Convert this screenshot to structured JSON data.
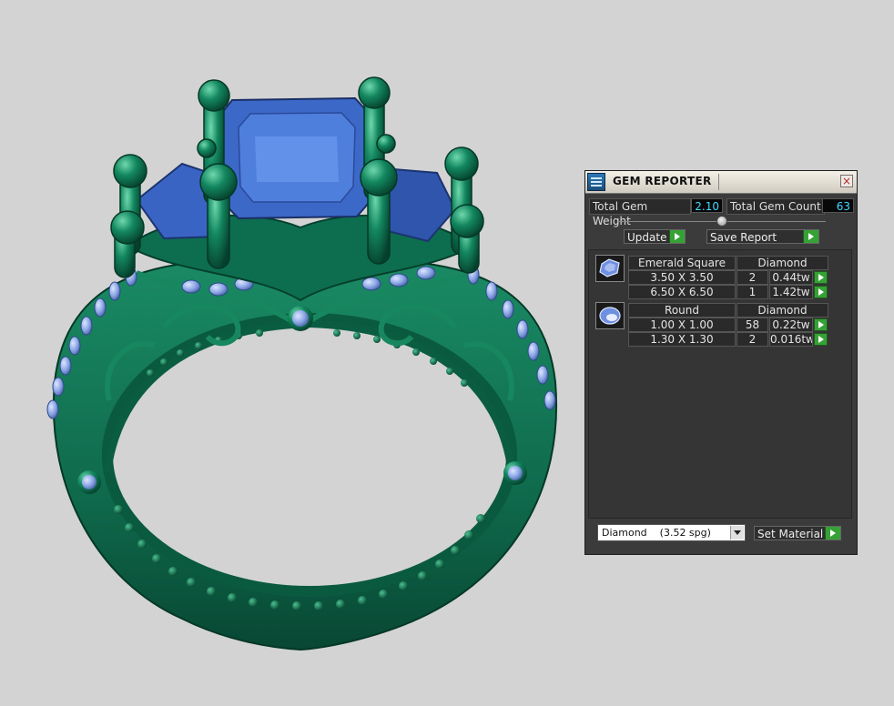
{
  "panel": {
    "title": "GEM REPORTER",
    "close_label": "×",
    "total_weight_label": "Total Gem Weight",
    "total_weight_value": "2.10",
    "total_count_label": "Total Gem Count",
    "total_count_value": "63",
    "update_label": "Update",
    "save_label": "Save Report",
    "material_select": "Diamond    (3.52 spg)",
    "set_material_label": "Set Material"
  },
  "groups": [
    {
      "shape": "Emerald Square",
      "material": "Diamond",
      "icon": "emerald-square-gem-icon",
      "rows": [
        {
          "size": "3.50 X 3.50",
          "count": "2",
          "weight": "0.44tw"
        },
        {
          "size": "6.50 X 6.50",
          "count": "1",
          "weight": "1.42tw"
        }
      ]
    },
    {
      "shape": "Round",
      "material": "Diamond",
      "icon": "round-gem-icon",
      "rows": [
        {
          "size": "1.00 X 1.00",
          "count": "58",
          "weight": "0.22tw"
        },
        {
          "size": "1.30 X 1.30",
          "count": "2",
          "weight": "0.016tw"
        }
      ]
    }
  ],
  "colors": {
    "background": "#d3d3d3",
    "ring_metal": "#0f6a4c",
    "gem_blue": "#3a64c4",
    "small_gem": "#8aa4e4",
    "accent_value": "#3fd8ff",
    "play_green": "#36a236"
  }
}
